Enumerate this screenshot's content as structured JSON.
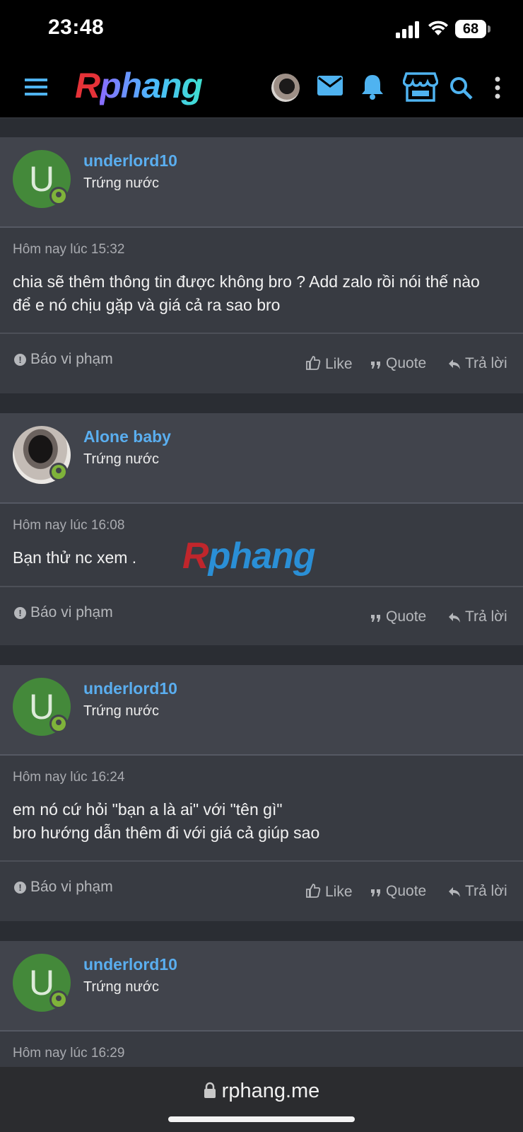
{
  "status": {
    "time": "23:48",
    "battery": "68"
  },
  "nav": {
    "logo_part1": "R",
    "logo_part2": "phang",
    "icons": [
      "menu-icon",
      "avatar",
      "mail-icon",
      "bell-icon",
      "store-icon",
      "search-icon",
      "more-vertical-icon"
    ]
  },
  "posts": [
    {
      "initial": "U",
      "username": "underlord10",
      "user_title": "Trứng nước",
      "date": "Hôm nay lúc 15:32",
      "body_lines": [
        "chia sẽ thêm thông tin được không bro ? Add zalo rồi nói thế nào",
        "để e nó chịu gặp và giá cả ra sao bro"
      ],
      "report": "Báo vi phạm",
      "like": "Like",
      "quote": "Quote",
      "reply": "Trả lời"
    },
    {
      "username": "Alone baby",
      "user_title": "Trứng nước",
      "date": "Hôm nay lúc 16:08",
      "body_lines": [
        "Bạn thử nc xem ."
      ],
      "report": "Báo vi phạm",
      "quote": "Quote",
      "reply": "Trả lời"
    },
    {
      "initial": "U",
      "username": "underlord10",
      "user_title": "Trứng nước",
      "date": "Hôm nay lúc 16:24",
      "body_lines": [
        "em nó cứ hỏi \"bạn a là ai\" với \"tên gì\"",
        "bro hướng dẫn thêm đi với giá cả giúp sao"
      ],
      "report": "Báo vi phạm",
      "like": "Like",
      "quote": "Quote",
      "reply": "Trả lời"
    },
    {
      "initial": "U",
      "username": "underlord10",
      "user_title": "Trứng nước",
      "date": "Hôm nay lúc 16:29"
    }
  ],
  "watermark": {
    "part1": "R",
    "part2": "phang"
  },
  "url": "rphang.me",
  "colors": {
    "accent": "#5aaeef",
    "avatar_green": "#44893a",
    "online": "#7fb33a",
    "background": "#2a2d33"
  }
}
